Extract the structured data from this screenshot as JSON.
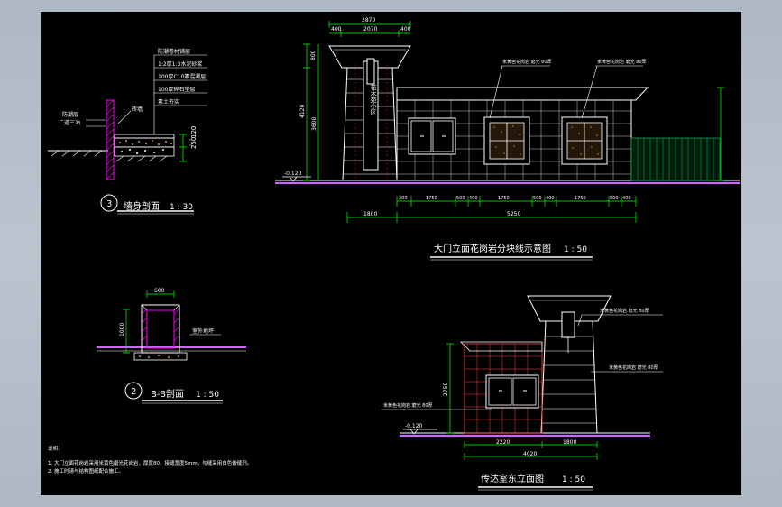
{
  "colors": {
    "background": "#000000",
    "frame": "#aeb7c4",
    "line": "#ffffff",
    "dim": "#00ff00",
    "accent": "#ff0000",
    "ground": "#cc66ff",
    "hatch_wall": "#ff00ff",
    "planting": "#00aa55"
  },
  "wall_section": {
    "title": "墙身剖面",
    "scale": "1 : 30",
    "circle_num": "3",
    "layers": [
      "防潮卷材铺层",
      "1:2厚1:3水泥砂浆",
      "100厚C10素混凝层",
      "100厚碎石垫层",
      "素土夯实"
    ],
    "left_notes": [
      "防潮层",
      "二道三油"
    ],
    "wall_note": "砖墙",
    "dims": [
      "250",
      "120"
    ]
  },
  "bb_section": {
    "title": "B-B剖面",
    "scale": "1 : 50",
    "circle_num": "2",
    "top_dim": "600",
    "side_dim": "1000",
    "label": "室外地坪"
  },
  "gate_elevation": {
    "title": "大门立面花岗岩分块线示意图",
    "scale": "1 : 50",
    "top_dims": [
      "2870",
      "400",
      "2070",
      "400"
    ],
    "left_dims": [
      "800",
      "4120",
      "3600"
    ],
    "level": "-0.120",
    "vertical_text": "花木苑小区",
    "notes": [
      "米黄色花岗岩 磨光 80厚",
      "米黄色花岗岩 磨光 80厚"
    ],
    "bottom_dims": [
      "300",
      "1750",
      "500",
      "400",
      "1750",
      "500",
      "400",
      "1750",
      "500",
      "400"
    ],
    "dim_1800": "1800",
    "dim_total": "5250"
  },
  "guard_elevation": {
    "title": "传达室东立面图",
    "scale": "1 : 50",
    "notes": [
      "米黄色花岗岩 磨光 80厚",
      "米黄色花岗岩 磨光 80厚",
      "米黄色花岗岩 磨光 80厚"
    ],
    "level": "-0.120",
    "left_dim": "2750",
    "bottom_dims": [
      "2220",
      "1800"
    ],
    "total_dim": "4020"
  },
  "notes_block": {
    "heading": "说明：",
    "lines": [
      "1. 大门立面花岗岩采用米黄色磨光花岗岩，厚度80，接缝宽度5mm，勾缝采用白色嵌缝剂。",
      "2. 施工时请与结构图纸配合施工。"
    ]
  }
}
